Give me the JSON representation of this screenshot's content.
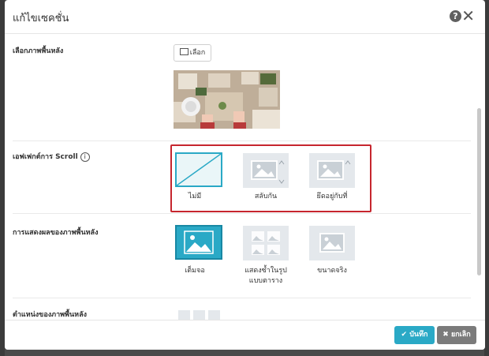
{
  "modal": {
    "title": "แก้ไขเซคชั่น",
    "help_icon": "question-circle-icon",
    "close_icon": "close-icon"
  },
  "background_image": {
    "label": "เลือกภาพพื้นหลัง",
    "choose_button": "เลือก"
  },
  "scroll_effect": {
    "label": "เอฟเฟกต์การ Scroll",
    "info_icon": "info-icon",
    "options": [
      {
        "label": "ไม่มี",
        "icon": "none-diagonal-icon",
        "selected": true
      },
      {
        "label": "สลับกัน",
        "icon": "parallax-image-icon",
        "selected": false
      },
      {
        "label": "ยึดอยู่กับที่",
        "icon": "fixed-image-icon",
        "selected": false
      }
    ]
  },
  "display": {
    "label": "การแสดงผลของภาพพื้นหลัง",
    "options": [
      {
        "label": "เต็มจอ",
        "icon": "fullscreen-image-icon",
        "selected": true
      },
      {
        "label_line1": "แสดงซ้ำในรูป",
        "label_line2": "แบบตาราง",
        "icon": "grid-repeat-image-icon",
        "selected": false
      },
      {
        "label": "ขนาดจริง",
        "icon": "actual-size-image-icon",
        "selected": false
      }
    ]
  },
  "position": {
    "label": "ตำแหน่งของภาพพื้นหลัง"
  },
  "footer": {
    "save_label": "บันทึก",
    "cancel_label": "ยกเลิก"
  },
  "colors": {
    "accent": "#2aa9c6",
    "highlight_border": "#c6262e",
    "cancel": "#7b7b7b"
  }
}
